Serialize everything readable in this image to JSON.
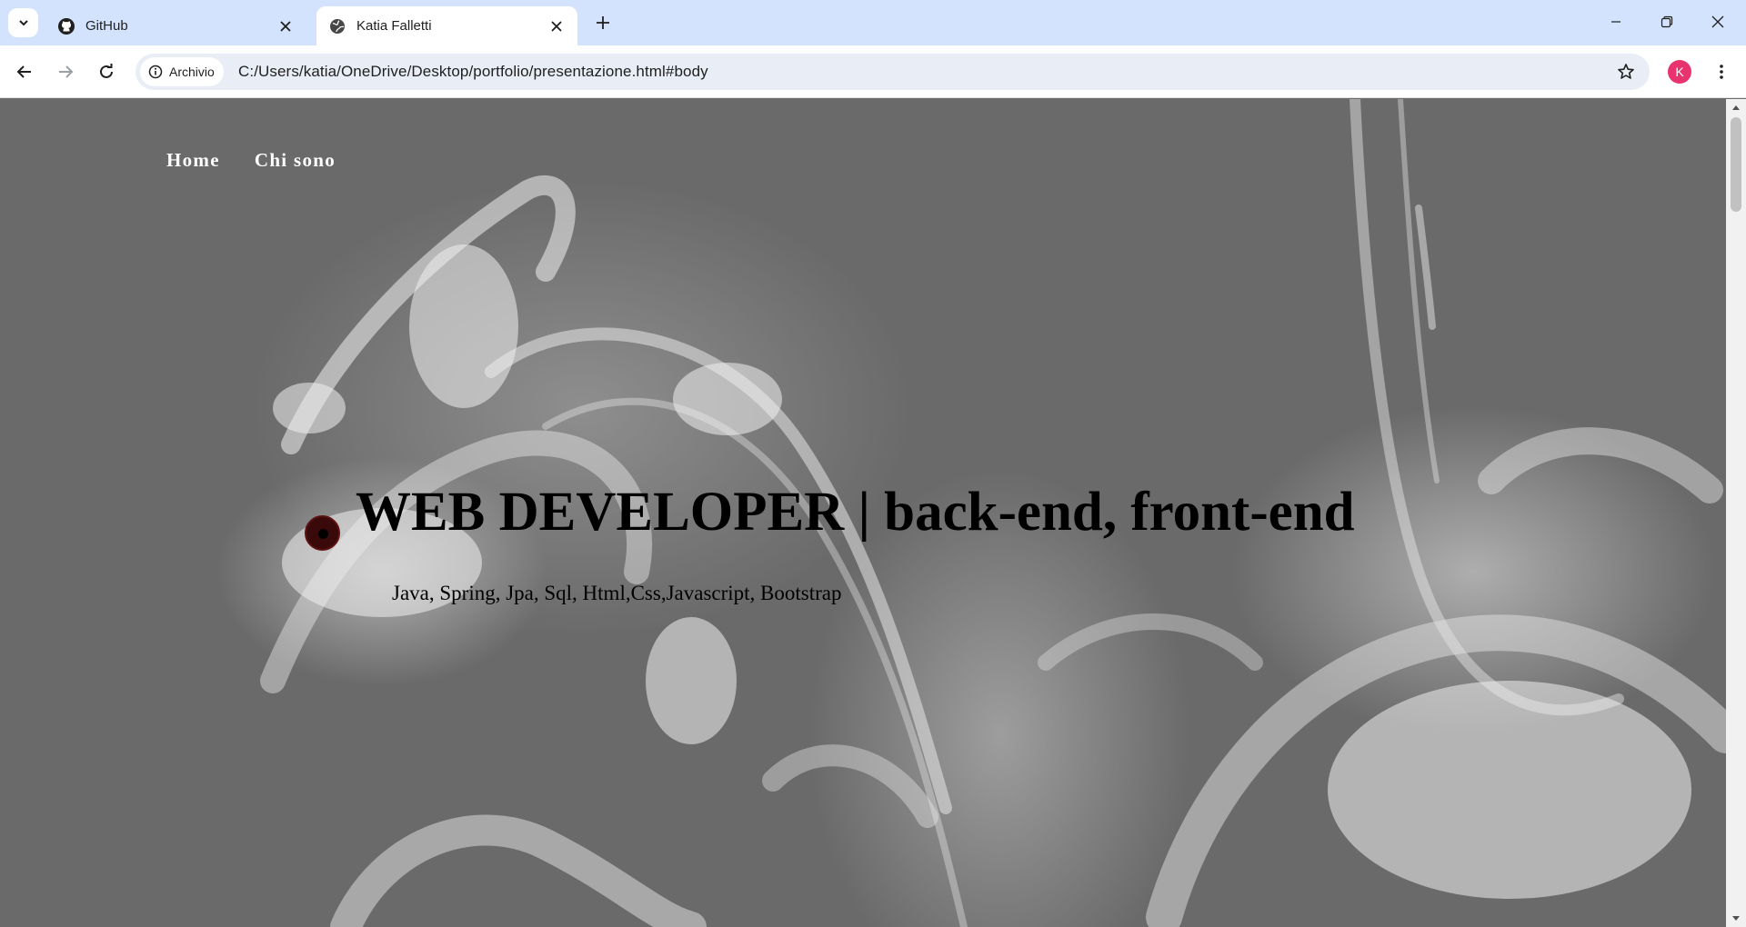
{
  "browser": {
    "tabs": [
      {
        "title": "GitHub",
        "icon": "github-icon",
        "active": false
      },
      {
        "title": "Katia Falletti",
        "icon": "globe-icon",
        "active": true
      }
    ],
    "site_chip_label": "Archivio",
    "url": "C:/Users/katia/OneDrive/Desktop/portfolio/presentazione.html#body",
    "profile_initial": "K",
    "accent_color": "#e8336f"
  },
  "page": {
    "nav": [
      {
        "label": "Home"
      },
      {
        "label": "Chi sono"
      }
    ],
    "hero": {
      "title": "WEB DEVELOPER | back-end, front-end",
      "subtitle": "Java, Spring, Jpa, Sql, Html,Css,Javascript, Bootstrap"
    }
  }
}
